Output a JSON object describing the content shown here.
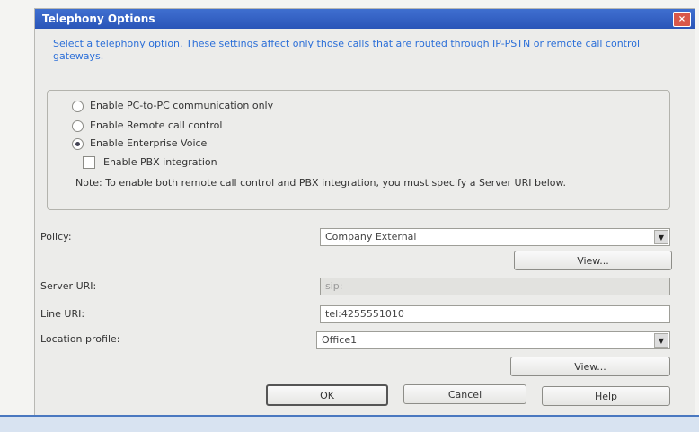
{
  "dialog": {
    "title": "Telephony Options",
    "close_label": "×",
    "description": "Select a telephony option. These settings affect only those calls that are routed through IP-PSTN or remote call control gateways."
  },
  "options": [
    {
      "label": "Enable PC-to-PC communication only",
      "selected": false
    },
    {
      "label": "Enable Remote call control",
      "selected": false
    },
    {
      "label": "Enable Enterprise Voice",
      "selected": true
    }
  ],
  "pbx": {
    "label": "Enable PBX integration",
    "checked": false
  },
  "note": "Note: To enable both remote call control and PBX integration, you must specify a Server URI below.",
  "policy": {
    "label": "Policy:",
    "value": "Company External",
    "view_label": "View..."
  },
  "server_uri": {
    "label": "Server URI:",
    "value": "sip:"
  },
  "line_uri": {
    "label": "Line URI:",
    "value": "tel:4255551010"
  },
  "location_profile": {
    "label": "Location profile:",
    "value": "Office1",
    "view_label": "View..."
  },
  "buttons": {
    "ok": "OK",
    "cancel": "Cancel",
    "help": "Help"
  }
}
